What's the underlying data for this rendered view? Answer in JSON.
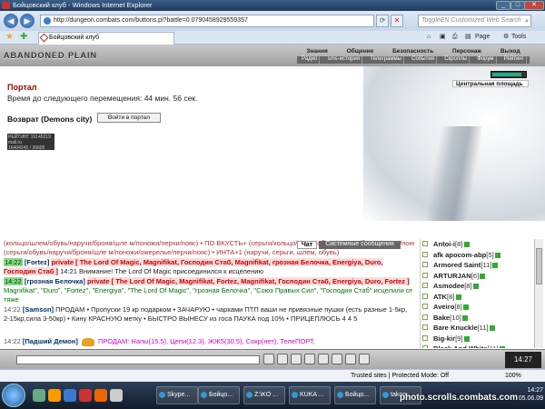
{
  "window": {
    "title": "Бойцовский клуб - Windows Internet Explorer"
  },
  "browser": {
    "url": "http://dungeon.combats.com/buttons.pl?battle=0.0790458929559357",
    "search_placeholder": "ToggleEN Customized Web Search",
    "tab_title": "Бойцовский клуб",
    "page_menu": "Page",
    "tools_menu": "Tools"
  },
  "game": {
    "logo": "ABANDONED PLAIN",
    "top_nav": [
      "Знания",
      "Общение",
      "Безопасность",
      "Персонаж",
      "Выход"
    ],
    "sub_nav": [
      "Радио",
      "sms-история",
      "Телеграммы",
      "События",
      "Скроллы",
      "Форум",
      "Рейтинг"
    ],
    "location_button": "Центральная площадь",
    "hp_fraction": 0.85,
    "portal": {
      "title": "Портал",
      "timer": "Время до следующего перемещения: 44 мин. 56 сек.",
      "return_label": "Возврат (Demons city)",
      "go_button": "Войти в портал"
    },
    "counter": {
      "line1": "РЕЙТИНГ 16145219",
      "line2": "mail.ru",
      "line3": "16404245 / 36605"
    },
    "chat_tabs": [
      "Чат",
      "Системные сообщения"
    ],
    "chat_lines": [
      {
        "time": "",
        "nick": "",
        "text": "(кольцо/шлем/обувь/наручи/броня/шле м/поножи/перчи/пояс) • ПО ВКУСТЬ+ (серьги/кольцо/шлем/обувь/наручи/броня/шлем/поножи/ожерелье/перчи/пояс)"
      },
      {
        "time": "",
        "nick": "",
        "text": "(серьги/обувь/наручи/броня/шле м/поножи/ожерелье/перчи/пояс) • ИНТА+1 (наручи, серьги, шлем, обувь)"
      },
      {
        "time": "14:22",
        "nick": "[Fortez]",
        "priv": "private [ The Lord Of Magic, Magnifikat, Господин Стаб, Magnifikat, грозная Белочка, Energiya, Duro, Господин Стаб ]",
        "text": "14:21 Внимание! The Lord Of Magic присоединился к исцелению"
      },
      {
        "time": "14:22",
        "nick": "[грозная Белочка]",
        "priv": "private [ The Lord Of Magic, Magnifikat, Fortez, Magnifikat, Господин Стаб, Energiya, Duro, Fortez ]",
        "text": "Magnifikat\", \"Duro\", \"Fortez\", \"Energiya\", \"The Lord Of Magic\", \"грозная Белочка\", \"Союз Правых Сил\", \"Господин Стаб\" исцелили от тяже"
      },
      {
        "time": "14:22",
        "nick": "[Samson]",
        "text": "ПРОДАМ • Пропуски 19 кр подарком • ЗАЧАРУЮ • чарками ПТП ваши не привязные пушки (есть разные 1-5кр, 2-15кр,сила 3-50кр) • Кину КРАСНУЮ метку • БЫСТРО ВЫНЕСУ из госа ПАУКА под 10% • ПРИЦЕПЛЮСЬ 4 4 5"
      },
      {
        "time": "14:22",
        "nick": "[Падший Демон]",
        "text": "ПРОДАМ: Напы(15.5), Цепи(12.3), ЖЖ5(30.5), Сокр(нет), ТелеПОРТ,"
      }
    ],
    "online_users": [
      {
        "name": "Antoi-i",
        "level": "[8]"
      },
      {
        "name": "afk apocom-abp",
        "level": "[5]"
      },
      {
        "name": "Armored Saint",
        "level": "[11]"
      },
      {
        "name": "ARTURJAN",
        "level": "[6]"
      },
      {
        "name": "Asmodee",
        "level": "[8]"
      },
      {
        "name": "ATK",
        "level": "[8]"
      },
      {
        "name": "Aveiro",
        "level": "[8]"
      },
      {
        "name": "Bake",
        "level": "[10]"
      },
      {
        "name": "Bare Knuckle",
        "level": "[11]"
      },
      {
        "name": "Big-kir",
        "level": "[9]"
      },
      {
        "name": "Black And White",
        "level": "[11]"
      }
    ],
    "clock": "14:27"
  },
  "statusbar": {
    "security": "Trusted sites | Protected Mode: Off",
    "zoom": "100%"
  },
  "taskbar": {
    "buttons": [
      "Skype...",
      "Бойцо...",
      "Z:\\KO ...",
      "KUKA ...",
      "Бойцо...",
      "takoo ..."
    ],
    "time": "14:27",
    "date": "05.06.09"
  },
  "watermark": "photo.scrolls.combats.com",
  "colors": {
    "accent": "#900",
    "chat_time_bg": "#8d8",
    "private": "#c00"
  }
}
